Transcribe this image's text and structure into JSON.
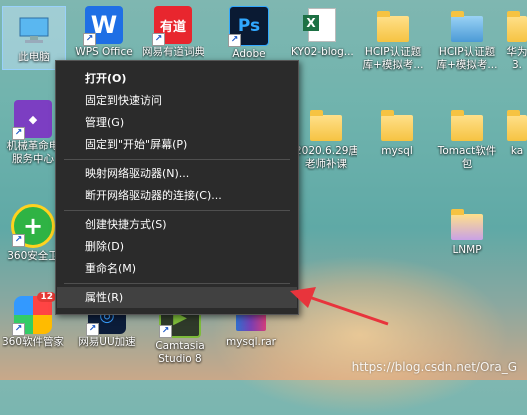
{
  "desktop": {
    "icons": [
      {
        "label": "此电脑"
      },
      {
        "label": "WPS Office"
      },
      {
        "label": "网易有道词典"
      },
      {
        "label": "Adobe"
      },
      {
        "label": "KY02-blog..."
      },
      {
        "label": "HCIP认证题"
      },
      {
        "label": "HCIP认证题"
      },
      {
        "label": "华为"
      },
      {
        "label": "机械革命电"
      },
      {
        "label": "服务中心"
      },
      {
        "label": "2020.6.29唐"
      },
      {
        "label": "老师补课"
      },
      {
        "label": "mysql"
      },
      {
        "label": "Tomact软件"
      },
      {
        "label": "包"
      },
      {
        "label": "ka"
      },
      {
        "label": "360安全卫"
      },
      {
        "label": "LNMP"
      },
      {
        "label": "360软件管家"
      },
      {
        "label": "网易UU加速"
      },
      {
        "label": "Camtasia"
      },
      {
        "label": "Studio 8"
      },
      {
        "label": "mysql.rar"
      },
      {
        "label": "库+模拟考..."
      },
      {
        "label": "库+模拟考..."
      },
      {
        "label": "3."
      }
    ],
    "badge_count": "12"
  },
  "context_menu": {
    "items": [
      {
        "label": "打开(O)"
      },
      {
        "label": "固定到快速访问"
      },
      {
        "label": "管理(G)"
      },
      {
        "label": "固定到\"开始\"屏幕(P)"
      },
      {
        "label": "映射网络驱动器(N)..."
      },
      {
        "label": "断开网络驱动器的连接(C)..."
      },
      {
        "label": "创建快捷方式(S)"
      },
      {
        "label": "删除(D)"
      },
      {
        "label": "重命名(M)"
      },
      {
        "label": "属性(R)"
      }
    ]
  },
  "watermark": "https://blog.csdn.net/Ora_G",
  "colors": {
    "menu_bg": "#2b2b2b",
    "arrow": "#e8343c"
  }
}
